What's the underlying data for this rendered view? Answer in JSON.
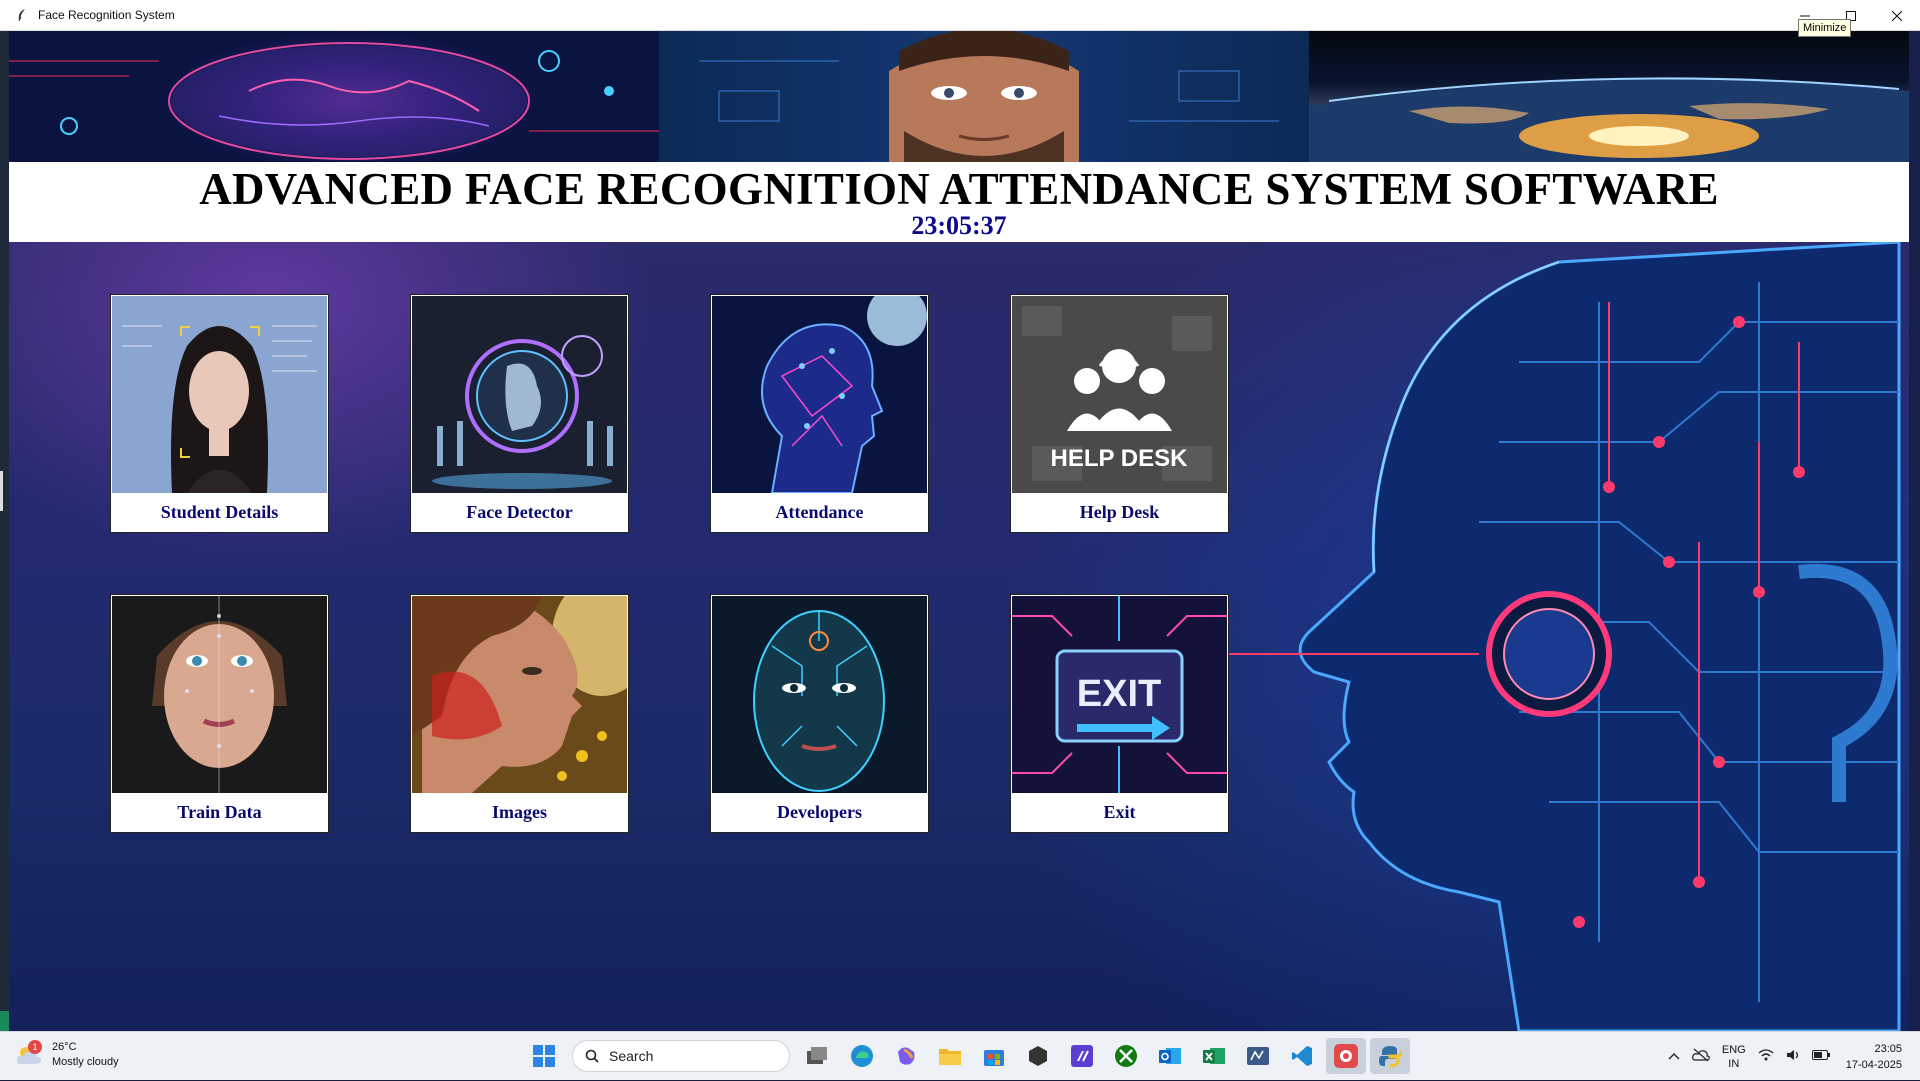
{
  "window": {
    "title": "Face Recognition System",
    "tooltip": "Minimize"
  },
  "header": {
    "title": "ADVANCED FACE RECOGNITION ATTENDANCE SYSTEM SOFTWARE",
    "clock": "23:05:37"
  },
  "tiles": [
    {
      "label": "Student Details",
      "icon": "student-photo"
    },
    {
      "label": "Face Detector",
      "icon": "face-detector-photo"
    },
    {
      "label": "Attendance",
      "icon": "attendance-photo"
    },
    {
      "label": "Help Desk",
      "icon": "help-desk-photo",
      "image_text": "HELP DESK"
    },
    {
      "label": "Train Data",
      "icon": "train-data-photo"
    },
    {
      "label": "Images",
      "icon": "images-photo"
    },
    {
      "label": "Developers",
      "icon": "developers-photo"
    },
    {
      "label": "Exit",
      "icon": "exit-photo",
      "image_text": "EXIT"
    }
  ],
  "taskbar": {
    "weather": {
      "temp": "26°C",
      "condition": "Mostly cloudy",
      "badge": "1"
    },
    "search_label": "Search",
    "tray": {
      "lang": "ENG",
      "region": "IN",
      "time": "23:05",
      "date": "17-04-2025"
    }
  },
  "colors": {
    "tile_label": "#0a0a6e",
    "clock": "#0a0a8a",
    "title": "#000000"
  }
}
